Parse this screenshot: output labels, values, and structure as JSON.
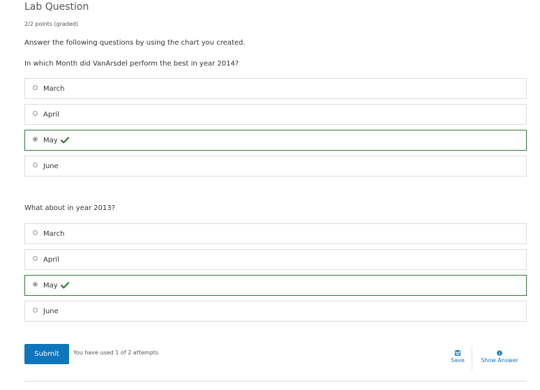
{
  "problem": {
    "title": "Lab Question",
    "points": "2/2 points (graded)",
    "instructions": "Answer the following questions by using the chart you created."
  },
  "question1": {
    "text": "In which Month did VanArsdel perform the best in year 2014?",
    "choices": [
      "March",
      "April",
      "May",
      "June"
    ],
    "selected": "May"
  },
  "question2": {
    "text": "What about in year 2013?",
    "choices": [
      "March",
      "April",
      "May",
      "June"
    ],
    "selected": "May"
  },
  "actions": {
    "submit_label": "Submit",
    "attempts_text": "You have used 1 of 2 attempts",
    "save_label": "Save",
    "show_answer_label": "Show Answer"
  },
  "icons": {
    "correct": "check-icon",
    "save": "floppy-disk-icon",
    "show_answer": "info-icon"
  },
  "colors": {
    "accent": "#0f75bc",
    "correct": "#2e7d32",
    "border": "#dddddd"
  }
}
